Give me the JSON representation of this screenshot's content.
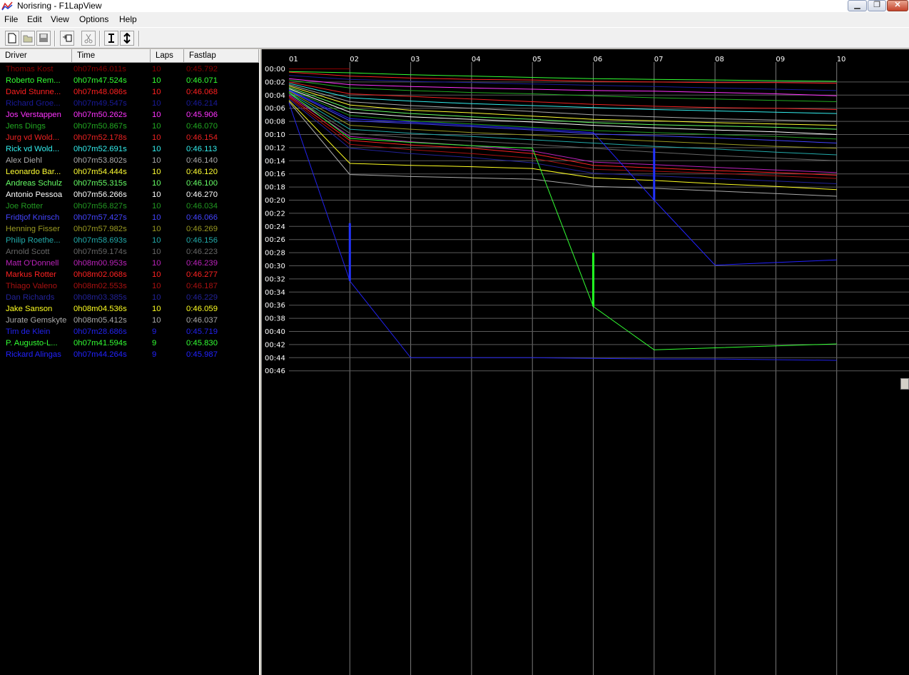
{
  "window": {
    "title": "Norisring - F1LapView",
    "minimize_glyph": "▁",
    "maximize_glyph": "❐",
    "close_glyph": "✕"
  },
  "menu": [
    "File",
    "Edit",
    "View",
    "Options",
    "Help"
  ],
  "toolbar": {
    "icons": [
      "new-file-icon",
      "open-folder-icon",
      "save-icon",
      "import-icon",
      "cut-icon",
      "text-cursor-icon",
      "vertical-resize-icon"
    ]
  },
  "list": {
    "headers": {
      "driver": "Driver",
      "time": "Time",
      "laps": "Laps",
      "fastlap": "Fastlap"
    },
    "rows": [
      {
        "driver": "Thomas Kost",
        "time": "0h07m46.011s",
        "laps": "10",
        "fastlap": "0:45.792",
        "color": "#8b0000"
      },
      {
        "driver": "Roberto Rem...",
        "time": "0h07m47.524s",
        "laps": "10",
        "fastlap": "0:46.071",
        "color": "#33ff33"
      },
      {
        "driver": "David Stunne...",
        "time": "0h07m48.086s",
        "laps": "10",
        "fastlap": "0:46.068",
        "color": "#ff2020"
      },
      {
        "driver": "Richard Groe...",
        "time": "0h07m49.547s",
        "laps": "10",
        "fastlap": "0:46.214",
        "color": "#1a1a9a"
      },
      {
        "driver": "Jos Verstappen",
        "time": "0h07m50.262s",
        "laps": "10",
        "fastlap": "0:45.906",
        "color": "#ff33ff"
      },
      {
        "driver": "Jens Dings",
        "time": "0h07m50.867s",
        "laps": "10",
        "fastlap": "0:46.070",
        "color": "#22aa22"
      },
      {
        "driver": "Jurg vd Wold...",
        "time": "0h07m52.178s",
        "laps": "10",
        "fastlap": "0:46.154",
        "color": "#ee2222"
      },
      {
        "driver": "Rick vd Wold...",
        "time": "0h07m52.691s",
        "laps": "10",
        "fastlap": "0:46.113",
        "color": "#33eeee"
      },
      {
        "driver": "Alex Diehl",
        "time": "0h07m53.802s",
        "laps": "10",
        "fastlap": "0:46.140",
        "color": "#aaaaaa"
      },
      {
        "driver": "Leonardo Bar...",
        "time": "0h07m54.444s",
        "laps": "10",
        "fastlap": "0:46.120",
        "color": "#ffff33"
      },
      {
        "driver": "Andreas Schulz",
        "time": "0h07m55.315s",
        "laps": "10",
        "fastlap": "0:46.100",
        "color": "#66ff66"
      },
      {
        "driver": "Antonio Pessoa",
        "time": "0h07m56.266s",
        "laps": "10",
        "fastlap": "0:46.270",
        "color": "#ffffff"
      },
      {
        "driver": "Joe Rotter",
        "time": "0h07m56.827s",
        "laps": "10",
        "fastlap": "0:46.034",
        "color": "#229922"
      },
      {
        "driver": "Fridtjof Knirsch",
        "time": "0h07m57.427s",
        "laps": "10",
        "fastlap": "0:46.066",
        "color": "#4444ff"
      },
      {
        "driver": "Henning Fisser",
        "time": "0h07m57.982s",
        "laps": "10",
        "fastlap": "0:46.269",
        "color": "#999922"
      },
      {
        "driver": "Philip Roethe...",
        "time": "0h07m58.693s",
        "laps": "10",
        "fastlap": "0:46.156",
        "color": "#22aaaa"
      },
      {
        "driver": "Arnold Scott",
        "time": "0h07m59.174s",
        "laps": "10",
        "fastlap": "0:46.223",
        "color": "#666666"
      },
      {
        "driver": "Matt O'Donnell",
        "time": "0h08m00.953s",
        "laps": "10",
        "fastlap": "0:46.239",
        "color": "#bb22bb"
      },
      {
        "driver": "Markus Rotter",
        "time": "0h08m02.068s",
        "laps": "10",
        "fastlap": "0:46.277",
        "color": "#ff2222"
      },
      {
        "driver": "Thiago Valeno",
        "time": "0h08m02.553s",
        "laps": "10",
        "fastlap": "0:46.187",
        "color": "#aa1111"
      },
      {
        "driver": "Dan Richards",
        "time": "0h08m03.385s",
        "laps": "10",
        "fastlap": "0:46.229",
        "color": "#222299"
      },
      {
        "driver": "Jake Sanson",
        "time": "0h08m04.536s",
        "laps": "10",
        "fastlap": "0:46.059",
        "color": "#ffff22"
      },
      {
        "driver": "Jurate Gemskyte",
        "time": "0h08m05.412s",
        "laps": "10",
        "fastlap": "0:46.037",
        "color": "#aaaaaa"
      },
      {
        "driver": "Tim de Klein",
        "time": "0h07m28.686s",
        "laps": "9",
        "fastlap": "0:45.719",
        "color": "#2222ee"
      },
      {
        "driver": "P. Augusto-L...",
        "time": "0h07m41.594s",
        "laps": "9",
        "fastlap": "0:45.830",
        "color": "#33ff33"
      },
      {
        "driver": "Rickard Alingas",
        "time": "0h07m44.264s",
        "laps": "9",
        "fastlap": "0:45.987",
        "color": "#2222ff"
      }
    ]
  },
  "chart_data": {
    "type": "line",
    "x_labels": [
      "01",
      "02",
      "03",
      "04",
      "05",
      "06",
      "07",
      "08",
      "09",
      "10"
    ],
    "y_labels": [
      "00:00",
      "00:02",
      "00:04",
      "00:06",
      "00:08",
      "00:10",
      "00:12",
      "00:14",
      "00:16",
      "00:18",
      "00:20",
      "00:22",
      "00:24",
      "00:26",
      "00:28",
      "00:30",
      "00:32",
      "00:34",
      "00:36",
      "00:38",
      "00:40",
      "00:42",
      "00:44",
      "00:46"
    ],
    "ylim": [
      0,
      46
    ],
    "grid": true,
    "series": [
      {
        "color": "#8b0000",
        "values": [
          0,
          0,
          null,
          null,
          null,
          null,
          null,
          null,
          null,
          null
        ]
      },
      {
        "color": "#33ff33",
        "values": [
          0.4,
          0.6,
          0.9,
          1.1,
          1.3,
          1.5,
          1.6,
          1.7,
          1.8,
          1.9
        ]
      },
      {
        "color": "#ff2020",
        "values": [
          0.5,
          1.1,
          1.4,
          1.6,
          1.7,
          1.9,
          2.0,
          2.1,
          2.1,
          2.2
        ]
      },
      {
        "color": "#1a1a9a",
        "values": [
          1.0,
          1.6,
          1.9,
          2.1,
          2.3,
          2.5,
          2.7,
          2.9,
          3.1,
          3.3
        ]
      },
      {
        "color": "#ff33ff",
        "values": [
          1.5,
          2.4,
          2.7,
          2.9,
          3.1,
          3.3,
          3.4,
          3.6,
          3.8,
          4.1
        ]
      },
      {
        "color": "#22aa22",
        "values": [
          1.7,
          2.9,
          3.3,
          3.6,
          3.8,
          4.1,
          4.4,
          4.6,
          4.8,
          5.0
        ]
      },
      {
        "color": "#ee2222",
        "values": [
          2.0,
          3.8,
          4.2,
          4.6,
          5.0,
          5.4,
          5.7,
          5.9,
          6.0,
          6.2
        ]
      },
      {
        "color": "#33eeee",
        "values": [
          2.2,
          4.4,
          4.9,
          5.3,
          5.6,
          5.9,
          6.2,
          6.4,
          6.6,
          6.8
        ]
      },
      {
        "color": "#aaaaaa",
        "values": [
          2.4,
          5.0,
          5.6,
          6.0,
          6.5,
          7.0,
          7.3,
          7.6,
          7.8,
          8.0
        ]
      },
      {
        "color": "#ffff33",
        "values": [
          2.6,
          5.5,
          6.3,
          6.7,
          7.2,
          7.7,
          7.9,
          8.2,
          8.4,
          8.6
        ]
      },
      {
        "color": "#66ff66",
        "values": [
          2.8,
          6.1,
          6.8,
          7.3,
          7.7,
          8.2,
          8.5,
          8.7,
          8.9,
          9.2
        ]
      },
      {
        "color": "#ffffff",
        "values": [
          3.0,
          6.6,
          7.3,
          7.7,
          8.1,
          8.6,
          9.0,
          9.3,
          9.6,
          10.0
        ]
      },
      {
        "color": "#229922",
        "values": [
          3.1,
          7.1,
          7.9,
          8.4,
          8.9,
          9.4,
          9.7,
          10.0,
          10.3,
          10.7
        ]
      },
      {
        "color": "#4444ff",
        "values": [
          3.3,
          7.9,
          8.3,
          8.8,
          9.3,
          9.9,
          10.2,
          10.5,
          10.9,
          11.3
        ]
      },
      {
        "color": "#999922",
        "values": [
          3.4,
          8.6,
          9.2,
          9.7,
          10.1,
          10.6,
          11.0,
          11.4,
          11.8,
          12.1
        ]
      },
      {
        "color": "#22aaaa",
        "values": [
          3.6,
          9.2,
          9.8,
          10.3,
          10.8,
          11.3,
          11.8,
          12.2,
          12.7,
          13.1
        ]
      },
      {
        "color": "#666666",
        "values": [
          3.8,
          9.8,
          10.5,
          11.0,
          11.5,
          12.1,
          12.7,
          13.2,
          13.6,
          14.0
        ]
      },
      {
        "color": "#bb22bb",
        "values": [
          4.0,
          10.3,
          11.1,
          11.7,
          12.5,
          14.2,
          14.6,
          15.0,
          15.4,
          15.8
        ]
      },
      {
        "color": "#ff2222",
        "values": [
          4.2,
          10.9,
          11.6,
          12.1,
          12.9,
          14.7,
          15.1,
          15.5,
          15.8,
          16.2
        ]
      },
      {
        "color": "#aa1111",
        "values": [
          4.4,
          11.5,
          12.3,
          12.9,
          13.6,
          15.3,
          15.6,
          15.9,
          16.3,
          16.7
        ]
      },
      {
        "color": "#222299",
        "values": [
          4.6,
          12.1,
          12.9,
          13.5,
          14.3,
          15.9,
          16.3,
          16.7,
          17.1,
          17.5
        ]
      },
      {
        "color": "#ffff22",
        "values": [
          4.8,
          14.4,
          14.7,
          14.9,
          15.2,
          16.6,
          17.0,
          17.5,
          17.9,
          18.4
        ]
      },
      {
        "color": "#aaaaaa",
        "values": [
          5.0,
          16.1,
          16.4,
          16.6,
          16.8,
          17.9,
          18.2,
          18.6,
          19.0,
          19.4
        ]
      },
      {
        "color": "#2222ee",
        "values": [
          5.2,
          32.3,
          44.0,
          44.0,
          44.0,
          44.1,
          44.2,
          44.2,
          44.3,
          44.4
        ]
      },
      {
        "color": "#33ff33",
        "values": [
          3.6,
          10.6,
          11.2,
          11.7,
          12.1,
          36.2,
          42.8,
          42.5,
          42.2,
          41.9
        ]
      },
      {
        "color": "#2222ff",
        "values": [
          3.2,
          7.6,
          8.1,
          8.6,
          9.1,
          9.7,
          20.0,
          29.9,
          29.5,
          29.1
        ]
      }
    ],
    "pit_segments": [
      {
        "color": "#2233ff",
        "x_index": 1,
        "y_from": 23.5,
        "y_to": 32.3
      },
      {
        "color": "#22ff22",
        "x_index": 5,
        "y_from": 28.0,
        "y_to": 36.2
      },
      {
        "color": "#2233ff",
        "x_index": 6,
        "y_from": 12.1,
        "y_to": 20.0
      }
    ]
  }
}
